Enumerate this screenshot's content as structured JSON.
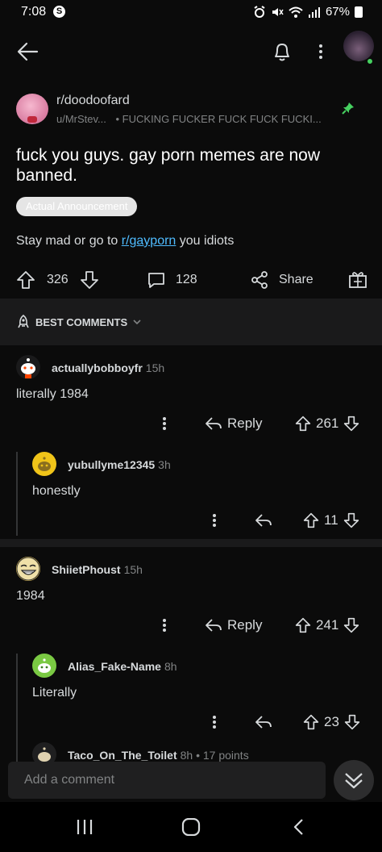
{
  "status": {
    "time": "7:08",
    "battery": "67%",
    "badge": "S"
  },
  "post": {
    "subreddit": "r/doodoofard",
    "author": "u/MrStev...",
    "author_flair": "• FUCKING FUCKER FUCK FUCK FUCKI...",
    "title": "fuck you guys. gay porn memes are now banned.",
    "flair": "Actual Announcement",
    "body_prefix": "Stay mad or go to ",
    "body_link": "r/gayporn",
    "body_suffix": " you idiots",
    "upvotes": "326",
    "comments": "128",
    "share_label": "Share"
  },
  "sort": {
    "label": "BEST COMMENTS"
  },
  "comments": [
    {
      "user": "actuallybobboyfr",
      "age": "15h",
      "text": "literally 1984",
      "reply_label": "Reply",
      "votes": "261"
    },
    {
      "user": "yubullyme12345",
      "age": "3h",
      "text": "honestly",
      "votes": "11"
    },
    {
      "user": "ShiietPhoust",
      "age": "15h",
      "text": "1984",
      "reply_label": "Reply",
      "votes": "241"
    },
    {
      "user": "Alias_Fake-Name",
      "age": "8h",
      "text": "Literally",
      "votes": "23"
    },
    {
      "user": "Taco_On_The_Toilet",
      "age": "8h • 17 points"
    }
  ],
  "composer": {
    "placeholder": "Add a comment"
  },
  "colors": {
    "link": "#4fbcff",
    "pin": "#46d160",
    "flair_bg": "#e5e5e5"
  }
}
